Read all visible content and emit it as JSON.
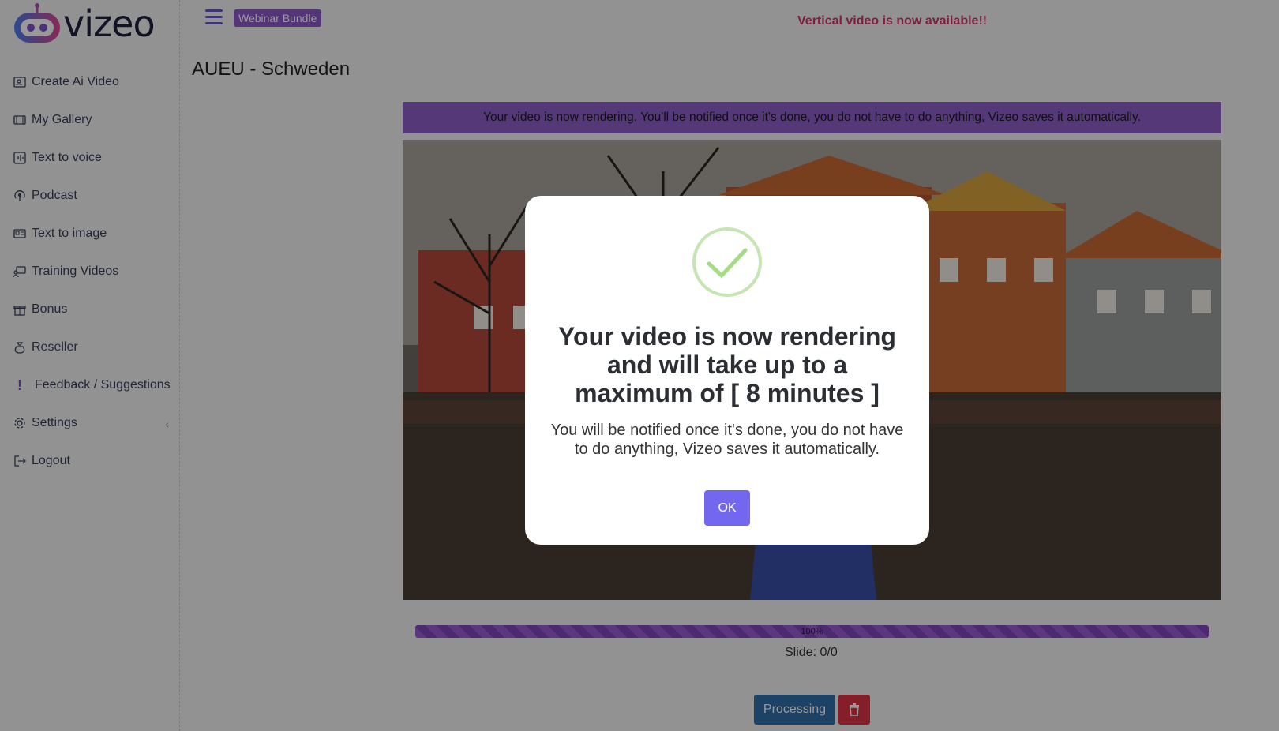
{
  "logo": {
    "text": "vizeo"
  },
  "sidebar": {
    "items": [
      {
        "label": "Create Ai Video",
        "icon": "video-camera-icon"
      },
      {
        "label": "My Gallery",
        "icon": "film-icon"
      },
      {
        "label": "Text to voice",
        "icon": "voice-icon"
      },
      {
        "label": "Podcast",
        "icon": "podcast-icon"
      },
      {
        "label": "Text to image",
        "icon": "image-icon"
      },
      {
        "label": "Training Videos",
        "icon": "training-icon"
      },
      {
        "label": "Bonus",
        "icon": "gift-icon"
      },
      {
        "label": "Reseller",
        "icon": "money-bag-icon"
      },
      {
        "label": "Feedback / Suggestions",
        "icon": "exclamation-icon"
      },
      {
        "label": "Settings",
        "icon": "gear-icon"
      },
      {
        "label": "Logout",
        "icon": "logout-icon"
      }
    ]
  },
  "topbar": {
    "bundle_label": "Webinar Bundle",
    "announcement": "Vertical video is now available!!"
  },
  "page": {
    "title": "AUEU - Schweden",
    "banner": "Your video is now rendering. You'll be notified once it's done, you do not have to do anything, Vizeo saves it automatically.",
    "progress_label": "100%",
    "progress_value": 1.0,
    "slide_text": "Slide: 0/0",
    "processing_label": "Processing"
  },
  "modal": {
    "title": "Your video is now rendering and will take up to a maximum of [ 8 minutes ]",
    "text": "You will be notified once it's done, you do not have to do anything, Vizeo saves it automatically.",
    "ok_label": "OK"
  },
  "colors": {
    "accent": "#8c5ec9",
    "announcement": "#d6336c",
    "ok_button": "#7367f0",
    "success": "#a5dc86",
    "processing": "#2f6fa8",
    "delete": "#dc3545"
  }
}
